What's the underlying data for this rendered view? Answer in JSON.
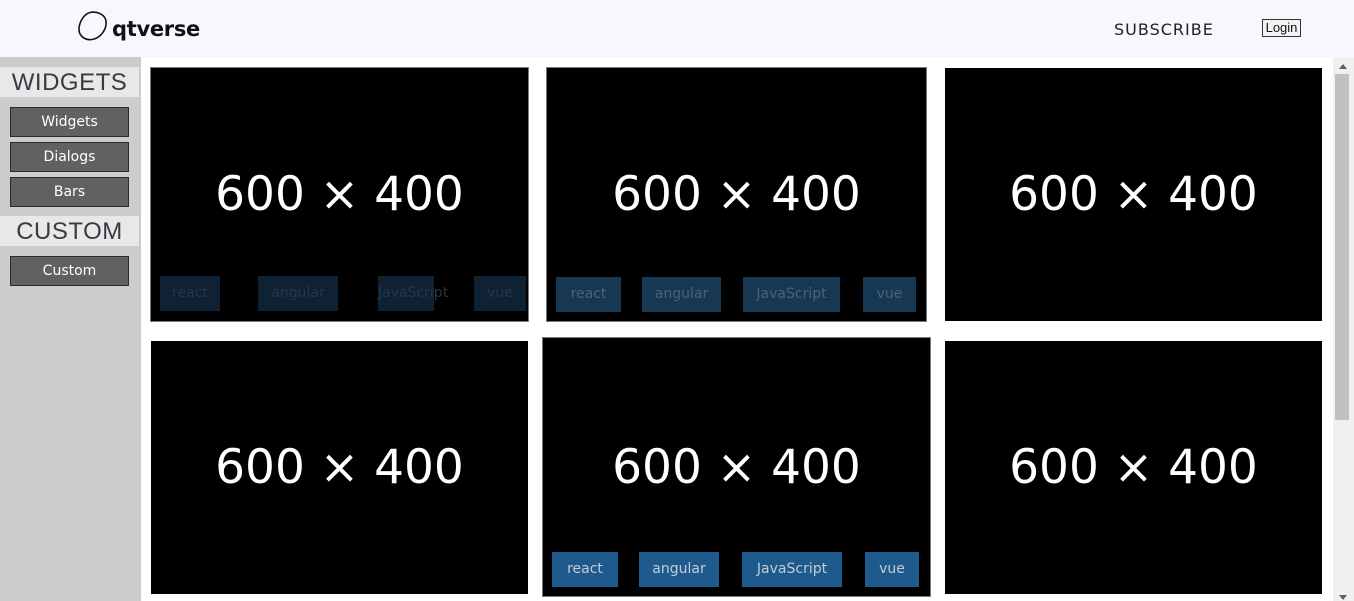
{
  "header": {
    "brand_name": "qtverse",
    "logo_icon": "blob-logo-icon",
    "subscribe_label": "SUBSCRIBE",
    "login_label": "Login"
  },
  "sidebar": {
    "sections": [
      {
        "title": "WIDGETS",
        "items": [
          "Widgets",
          "Dialogs",
          "Bars"
        ]
      },
      {
        "title": "CUSTOM",
        "items": [
          "Custom"
        ]
      }
    ]
  },
  "cards": [
    {
      "label": "600 × 400",
      "tags": [
        "react",
        "angular",
        "JavaScript",
        "vue"
      ],
      "tag_visibility": "faint"
    },
    {
      "label": "600 × 400",
      "tags": [
        "react",
        "angular",
        "JavaScript",
        "vue"
      ],
      "tag_visibility": "mid"
    },
    {
      "label": "600 × 400",
      "tags": [],
      "tag_visibility": "none"
    },
    {
      "label": "600 × 400",
      "tags": [],
      "tag_visibility": "none"
    },
    {
      "label": "600 × 400",
      "tags": [
        "react",
        "angular",
        "JavaScript",
        "vue"
      ],
      "tag_visibility": "strong"
    },
    {
      "label": "600 × 400",
      "tags": [],
      "tag_visibility": "none"
    }
  ],
  "colors": {
    "header_bg": "#f8f7fd",
    "sidebar_bg": "#cccccc",
    "nav_button_bg": "#616161",
    "tag_bg": "#1f4a6c",
    "card_bg": "#000000"
  }
}
